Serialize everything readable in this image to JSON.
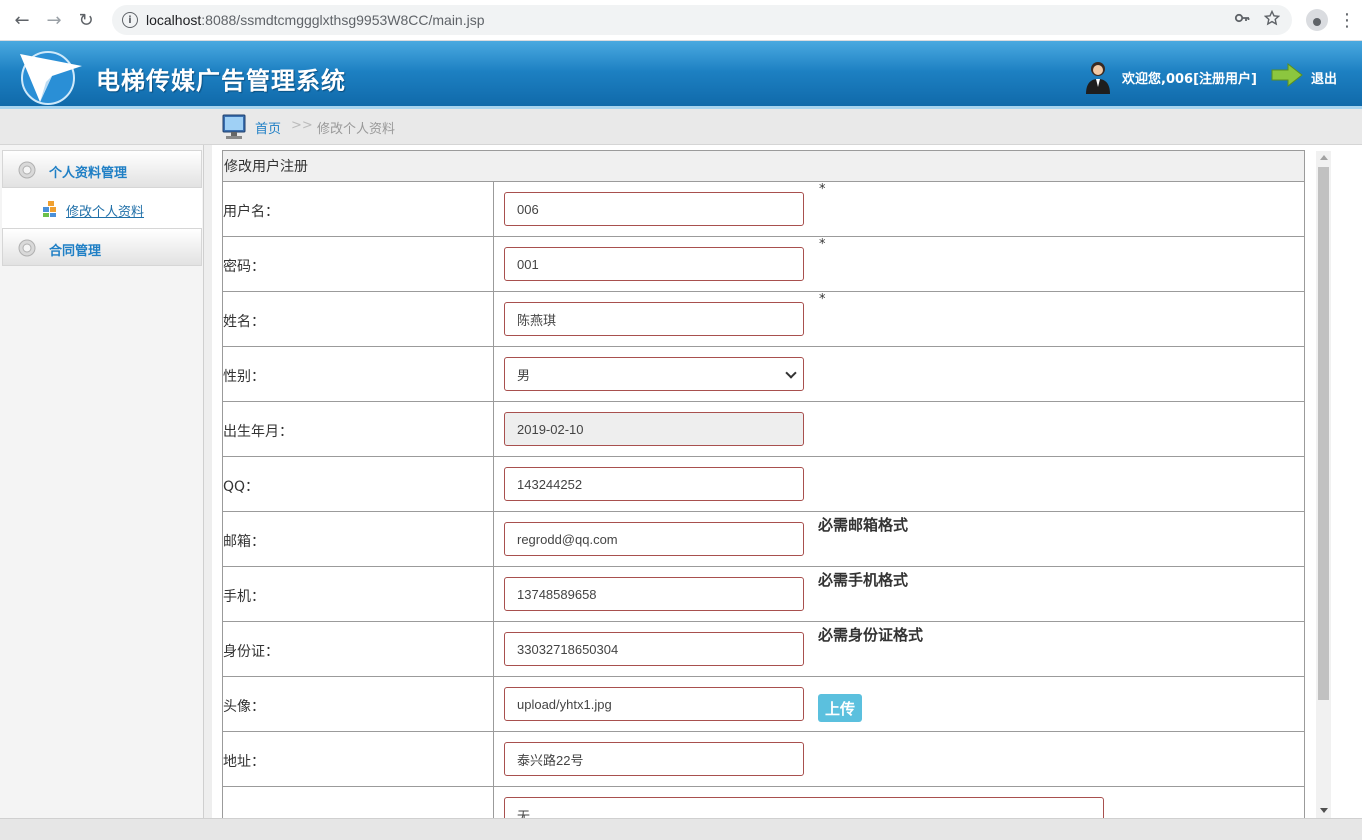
{
  "browser": {
    "url_host": "localhost",
    "url_path": ":8088/ssmdtcmggglxthsg9953W8CC/main.jsp",
    "icons": [
      "back-icon",
      "forward-icon",
      "reload-icon",
      "info-icon",
      "key-icon",
      "star-icon",
      "profile-icon",
      "menu-icon"
    ]
  },
  "header": {
    "title": "电梯传媒广告管理系统",
    "welcome": "欢迎您,006[注册用户]",
    "logout": "退出"
  },
  "breadcrumb": {
    "home": "首页",
    "separator": ">>",
    "current": "修改个人资料"
  },
  "sidebar": {
    "groups": [
      {
        "label": "个人资料管理",
        "items": [
          {
            "label": "修改个人资料"
          }
        ]
      },
      {
        "label": "合同管理",
        "items": []
      }
    ]
  },
  "form": {
    "title": "修改用户注册",
    "rows": [
      {
        "label": "用户名：",
        "value": "006",
        "required": "*"
      },
      {
        "label": "密码：",
        "value": "001",
        "required": "*"
      },
      {
        "label": "姓名：",
        "value": "陈燕琪",
        "required": "*"
      },
      {
        "label": "性别：",
        "value": "男"
      },
      {
        "label": "出生年月：",
        "value": "2019-02-10"
      },
      {
        "label": "QQ：",
        "value": "143244252"
      },
      {
        "label": "邮箱：",
        "value": "regrodd@qq.com",
        "hint": "必需邮箱格式"
      },
      {
        "label": "手机：",
        "value": "13748589658",
        "hint": "必需手机格式"
      },
      {
        "label": "身份证：",
        "value": "33032718650304",
        "hint": "必需身份证格式"
      },
      {
        "label": "头像：",
        "value": "upload/yhtx1.jpg",
        "button": "上传"
      },
      {
        "label": "地址：",
        "value": "泰兴路22号"
      },
      {
        "label": "",
        "value": "无"
      }
    ]
  },
  "colors": {
    "header_top": "#4aa9e0",
    "header_bottom": "#0f68a8",
    "link": "#1f7fc5",
    "field_border": "#a8504e",
    "upload_button": "#5bc0de"
  }
}
